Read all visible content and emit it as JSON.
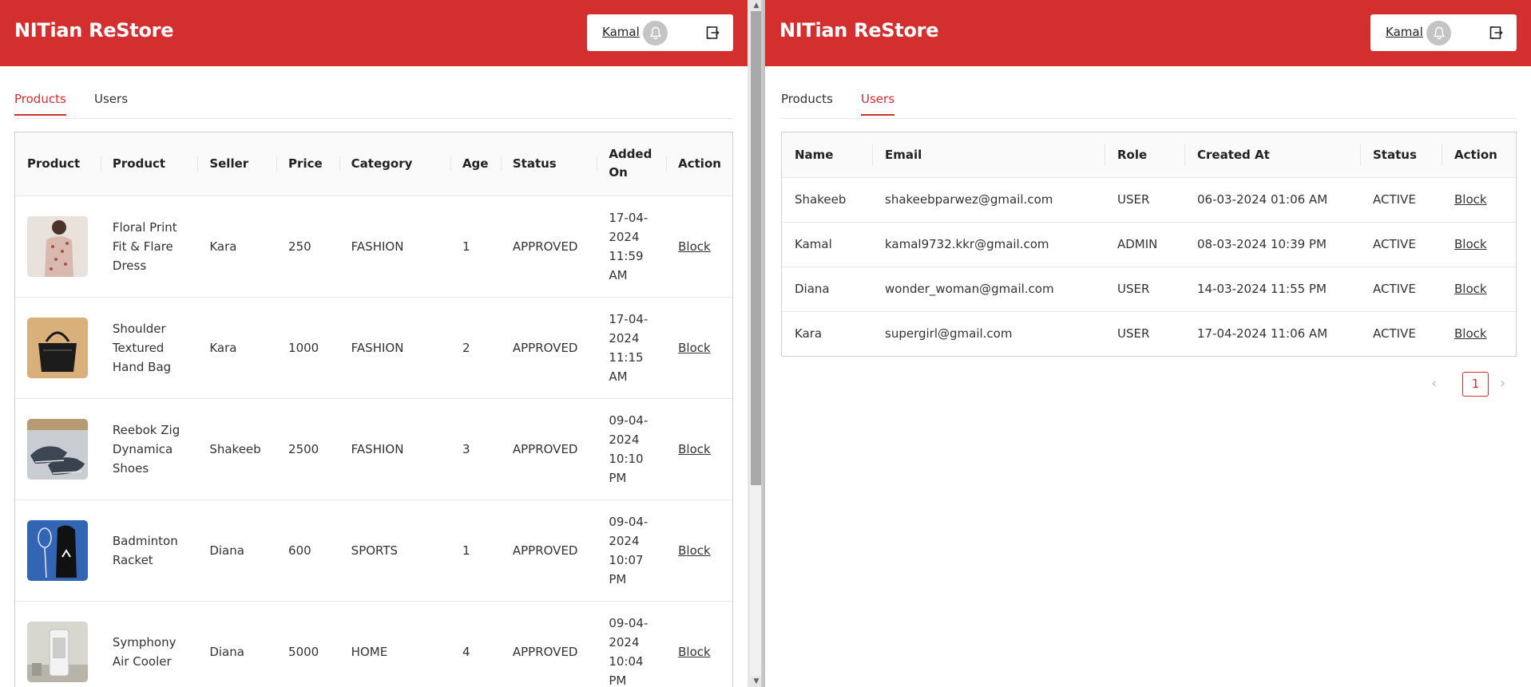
{
  "app": {
    "brand": "NITian ReStore",
    "username": "Kamal"
  },
  "tabs": [
    {
      "label": "Products"
    },
    {
      "label": "Users"
    }
  ],
  "products": {
    "headers": [
      "Product",
      "Product",
      "Seller",
      "Price",
      "Category",
      "Age",
      "Status",
      "Added On",
      "Action"
    ],
    "rows": [
      {
        "name": "Floral Print Fit & Flare Dress",
        "seller": "Kara",
        "price": "250",
        "category": "FASHION",
        "age": "1",
        "status": "APPROVED",
        "added": "17-04-2024 11:59 AM",
        "action": "Block",
        "thumb_icon": "dress-photo"
      },
      {
        "name": "Shoulder Textured Hand Bag",
        "seller": "Kara",
        "price": "1000",
        "category": "FASHION",
        "age": "2",
        "status": "APPROVED",
        "added": "17-04-2024 11:15 AM",
        "action": "Block",
        "thumb_icon": "handbag-photo"
      },
      {
        "name": "Reebok Zig Dynamica Shoes",
        "seller": "Shakeeb",
        "price": "2500",
        "category": "FASHION",
        "age": "3",
        "status": "APPROVED",
        "added": "09-04-2024 10:10 PM",
        "action": "Block",
        "thumb_icon": "shoes-photo"
      },
      {
        "name": "Badminton Racket",
        "seller": "Diana",
        "price": "600",
        "category": "SPORTS",
        "age": "1",
        "status": "APPROVED",
        "added": "09-04-2024 10:07 PM",
        "action": "Block",
        "thumb_icon": "racket-photo"
      },
      {
        "name": "Symphony Air Cooler",
        "seller": "Diana",
        "price": "5000",
        "category": "HOME",
        "age": "4",
        "status": "APPROVED",
        "added": "09-04-2024 10:04 PM",
        "action": "Block",
        "thumb_icon": "cooler-photo"
      }
    ]
  },
  "users": {
    "headers": [
      "Name",
      "Email",
      "Role",
      "Created At",
      "Status",
      "Action"
    ],
    "rows": [
      {
        "name": "Shakeeb",
        "email": "shakeebparwez@gmail.com",
        "role": "USER",
        "created": "06-03-2024 01:06 AM",
        "status": "ACTIVE",
        "action": "Block"
      },
      {
        "name": "Kamal",
        "email": "kamal9732.kkr@gmail.com",
        "role": "ADMIN",
        "created": "08-03-2024 10:39 PM",
        "status": "ACTIVE",
        "action": "Block"
      },
      {
        "name": "Diana",
        "email": "wonder_woman@gmail.com",
        "role": "USER",
        "created": "14-03-2024 11:55 PM",
        "status": "ACTIVE",
        "action": "Block"
      },
      {
        "name": "Kara",
        "email": "supergirl@gmail.com",
        "role": "USER",
        "created": "17-04-2024 11:06 AM",
        "status": "ACTIVE",
        "action": "Block"
      }
    ]
  },
  "pagination": {
    "current": "1"
  },
  "colors": {
    "brand": "#d32f2f"
  }
}
